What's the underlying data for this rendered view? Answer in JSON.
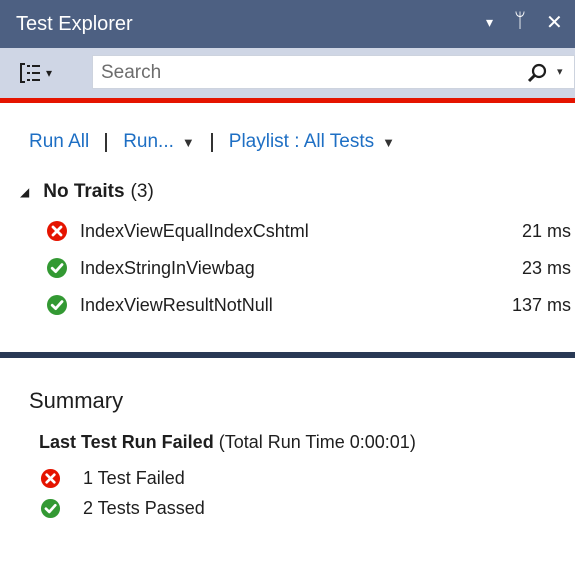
{
  "window": {
    "title": "Test Explorer",
    "controls": [
      "▾",
      "ᛘ",
      "✕"
    ]
  },
  "toolbar": {
    "group_dropdown": "▾",
    "search_placeholder": "Search",
    "search_dropdown": "▾"
  },
  "actions": {
    "run_all": "Run All",
    "run": "Run...",
    "playlist": "Playlist : All Tests"
  },
  "group": {
    "name": "No Traits",
    "count": "(3)",
    "tests": [
      {
        "name": "IndexViewEqualIndexCshtml",
        "duration": "21 ms",
        "status": "failed"
      },
      {
        "name": "IndexStringInViewbag",
        "duration": "23 ms",
        "status": "passed"
      },
      {
        "name": "IndexViewResultNotNull",
        "duration": "137 ms",
        "status": "passed"
      }
    ]
  },
  "summary": {
    "title": "Summary",
    "last_run": "Last Test Run Failed",
    "run_time": "(Total Run Time 0:00:01)",
    "failed": "1 Test Failed",
    "passed": "2 Tests Passed"
  },
  "colors": {
    "title_bar": "#4d6082",
    "toolbar": "#cfd6e5",
    "fail_bar": "#e51400",
    "link": "#1e6fc4",
    "fail_icon": "#e51400",
    "pass_icon": "#339933",
    "divider": "#293955"
  }
}
